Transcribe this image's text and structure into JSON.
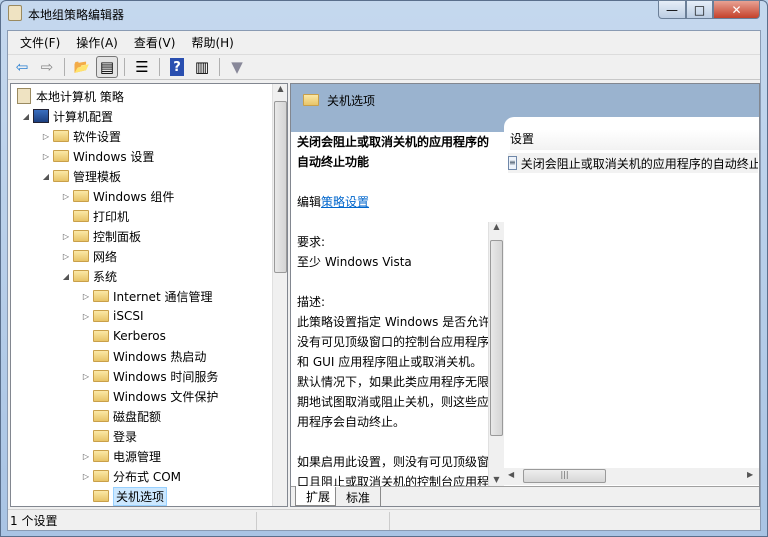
{
  "window": {
    "title": "本地组策略编辑器",
    "minimize": "—",
    "maximize": "□",
    "close": "✕"
  },
  "menu": [
    "文件(F)",
    "操作(A)",
    "查看(V)",
    "帮助(H)"
  ],
  "toolbar": [
    {
      "icon": "back-icon",
      "glyph": "⇦"
    },
    {
      "icon": "forward-icon",
      "glyph": "⇨"
    },
    {
      "icon": "up-folder-icon",
      "glyph": "📂"
    },
    {
      "icon": "show-hide-tree-icon",
      "glyph": "▤"
    },
    {
      "icon": "export-list-icon",
      "glyph": "☰"
    },
    {
      "icon": "help-icon",
      "glyph": "?"
    },
    {
      "icon": "show-action-pane-icon",
      "glyph": "▥"
    },
    {
      "icon": "filter-icon",
      "glyph": "▼"
    }
  ],
  "tree": [
    {
      "label": "本地计算机 策略",
      "level": 0,
      "state": "none",
      "icon": "policy"
    },
    {
      "label": "计算机配置",
      "level": 1,
      "state": "expanded",
      "icon": "computer"
    },
    {
      "label": "软件设置",
      "level": 2,
      "state": "collapsed"
    },
    {
      "label": "Windows 设置",
      "level": 2,
      "state": "collapsed"
    },
    {
      "label": "管理模板",
      "level": 2,
      "state": "expanded"
    },
    {
      "label": "Windows 组件",
      "level": 3,
      "state": "collapsed"
    },
    {
      "label": "打印机",
      "level": 3,
      "state": "none"
    },
    {
      "label": "控制面板",
      "level": 3,
      "state": "collapsed"
    },
    {
      "label": "网络",
      "level": 3,
      "state": "collapsed"
    },
    {
      "label": "系统",
      "level": 3,
      "state": "expanded"
    },
    {
      "label": "Internet 通信管理",
      "level": 4,
      "state": "collapsed"
    },
    {
      "label": "iSCSI",
      "level": 4,
      "state": "collapsed"
    },
    {
      "label": "Kerberos",
      "level": 4,
      "state": "none"
    },
    {
      "label": "Windows 热启动",
      "level": 4,
      "state": "none"
    },
    {
      "label": "Windows 时间服务",
      "level": 4,
      "state": "collapsed"
    },
    {
      "label": "Windows 文件保护",
      "level": 4,
      "state": "none"
    },
    {
      "label": "磁盘配额",
      "level": 4,
      "state": "none"
    },
    {
      "label": "登录",
      "level": 4,
      "state": "none"
    },
    {
      "label": "电源管理",
      "level": 4,
      "state": "collapsed"
    },
    {
      "label": "分布式 COM",
      "level": 4,
      "state": "collapsed"
    },
    {
      "label": "关机选项",
      "level": 4,
      "state": "none",
      "selected": true
    }
  ],
  "right": {
    "header": "关机选项",
    "desc_title": "关闭会阻止或取消关机的应用程序的自动终止功能",
    "edit_prefix": "编辑",
    "edit_link": "策略设置",
    "req_label": "要求:",
    "req_value": "至少 Windows Vista",
    "desc_label": "描述:",
    "desc_p1": "此策略设置指定 Windows 是否允许没有可见顶级窗口的控制台应用程序和 GUI 应用程序阻止或取消关机。默认情况下，如果此类应用程序无限期地试图取消或阻止关机，则这些应用程序会自动终止。",
    "desc_p2": "如果启用此设置，则没有可见顶级窗口且阻止或取消关机的控制台应用程序或 GUI 应用程序不会在关",
    "list_header": "设置",
    "list_items": [
      "关闭会阻止或取消关机的应用程序的自动终止功能"
    ],
    "tabs": [
      "扩展",
      "标准"
    ]
  },
  "status": "1 个设置"
}
